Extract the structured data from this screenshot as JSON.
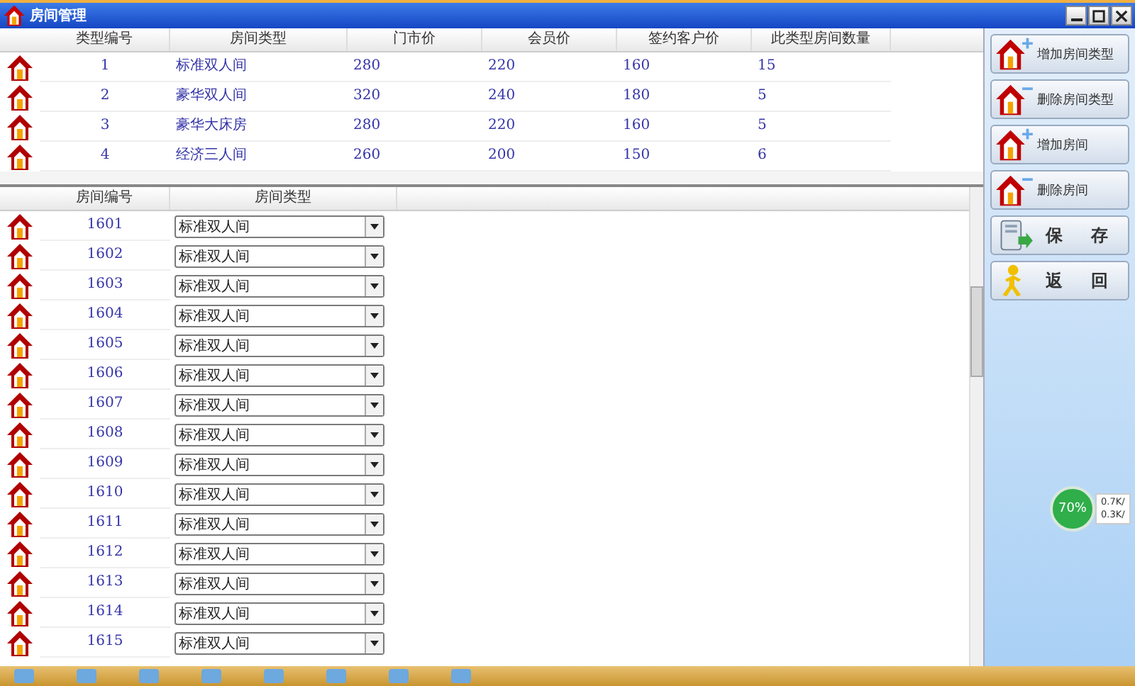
{
  "window": {
    "title": "房间管理"
  },
  "type_table": {
    "columns": [
      "类型编号",
      "房间类型",
      "门市价",
      "会员价",
      "签约客户价",
      "此类型房间数量"
    ],
    "rows": [
      [
        "1",
        "标准双人间",
        "280",
        "220",
        "160",
        "15"
      ],
      [
        "2",
        "豪华双人间",
        "320",
        "240",
        "180",
        "5"
      ],
      [
        "3",
        "豪华大床房",
        "280",
        "220",
        "160",
        "5"
      ],
      [
        "4",
        "经济三人间",
        "260",
        "200",
        "150",
        "6"
      ]
    ]
  },
  "room_table": {
    "columns": [
      "房间编号",
      "房间类型"
    ],
    "rows": [
      {
        "number": "1601",
        "type": "标准双人间"
      },
      {
        "number": "1602",
        "type": "标准双人间"
      },
      {
        "number": "1603",
        "type": "标准双人间"
      },
      {
        "number": "1604",
        "type": "标准双人间"
      },
      {
        "number": "1605",
        "type": "标准双人间"
      },
      {
        "number": "1606",
        "type": "标准双人间"
      },
      {
        "number": "1607",
        "type": "标准双人间"
      },
      {
        "number": "1608",
        "type": "标准双人间"
      },
      {
        "number": "1609",
        "type": "标准双人间"
      },
      {
        "number": "1610",
        "type": "标准双人间"
      },
      {
        "number": "1611",
        "type": "标准双人间"
      },
      {
        "number": "1612",
        "type": "标准双人间"
      },
      {
        "number": "1613",
        "type": "标准双人间"
      },
      {
        "number": "1614",
        "type": "标准双人间"
      },
      {
        "number": "1615",
        "type": "标准双人间"
      }
    ]
  },
  "actions": [
    {
      "label": "增加房间类型",
      "kind": "add"
    },
    {
      "label": "删除房间类型",
      "kind": "remove"
    },
    {
      "label": "增加房间",
      "kind": "add"
    },
    {
      "label": "删除房间",
      "kind": "remove"
    },
    {
      "label": "保　存",
      "kind": "save"
    },
    {
      "label": "返　回",
      "kind": "back"
    }
  ],
  "speed_widget": {
    "percent": "70%",
    "upload": "0.7K/",
    "download": "0.3K/"
  }
}
